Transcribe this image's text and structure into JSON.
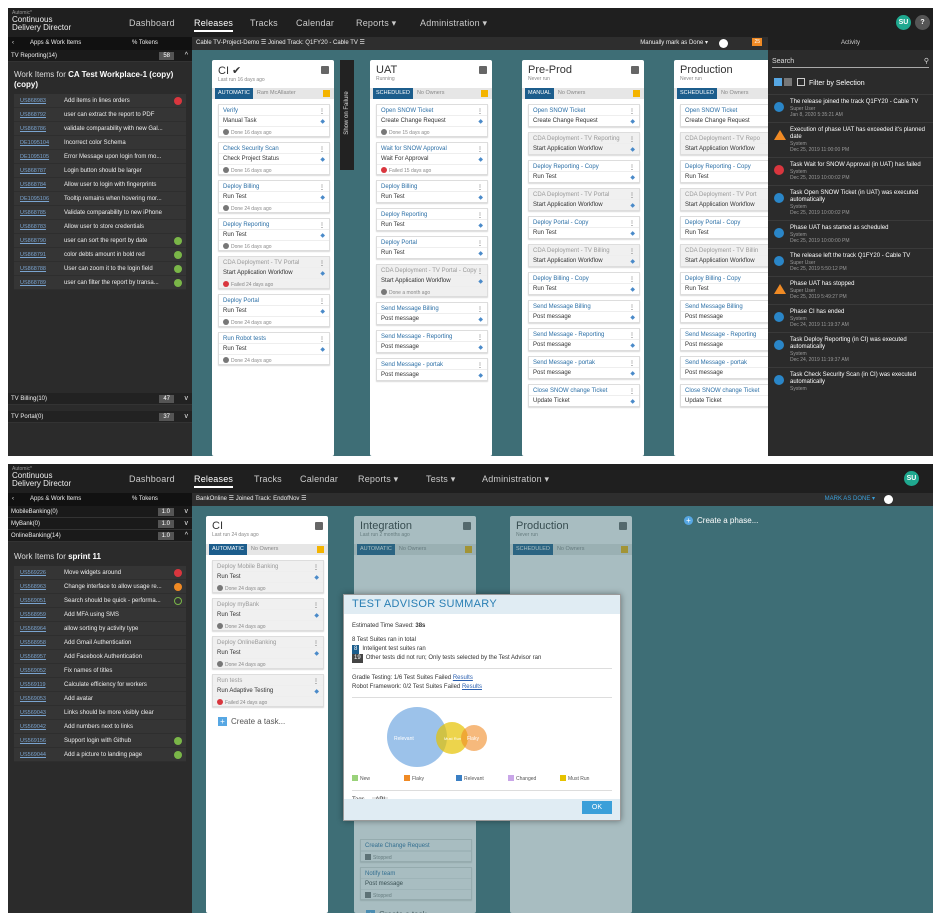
{
  "s1": {
    "brand_tag": "Automic*",
    "brand": "Continuous Delivery Director",
    "nav": [
      "Dashboard",
      "Releases",
      "Tracks",
      "Calendar",
      "Reports ▾",
      "Administration ▾"
    ],
    "avatar": "SU",
    "help": "?",
    "lefthead_apps": "Apps & Work Items",
    "lefthead_tokens": "% Tokens",
    "cat_top": {
      "label": "TV Reporting(14)",
      "count": "58"
    },
    "wi_title_pre": "Work Items for ",
    "wi_title_name": "CA Test Workplace-1 (copy) (copy)",
    "workitems": [
      {
        "id": "US868983",
        "title": "Add items in lines orders",
        "st": "red"
      },
      {
        "id": "US868792",
        "title": "user can extract the report to PDF",
        "st": ""
      },
      {
        "id": "US868786",
        "title": "validate comparability with new Gal...",
        "st": ""
      },
      {
        "id": "DE1095104",
        "title": "Incorrect color Schema",
        "st": ""
      },
      {
        "id": "DE1095105",
        "title": "Error Message upon login from mo...",
        "st": ""
      },
      {
        "id": "US868787",
        "title": "Login button should be larger",
        "st": ""
      },
      {
        "id": "US868784",
        "title": "Allow user to login with fingerprints",
        "st": ""
      },
      {
        "id": "DE1095106",
        "title": "Tooltip remains when hovering mor...",
        "st": ""
      },
      {
        "id": "US868785",
        "title": "Validate comparability to new iPhone",
        "st": ""
      },
      {
        "id": "US868783",
        "title": "Allow user to store credentials",
        "st": ""
      },
      {
        "id": "US868790",
        "title": "user can sort the report by date",
        "st": "green"
      },
      {
        "id": "US868791",
        "title": "color debts amount in bold red",
        "st": "green"
      },
      {
        "id": "US868788",
        "title": "User can zoom it to the login field",
        "st": "green"
      },
      {
        "id": "US868789",
        "title": "user can filter the report by transa...",
        "st": "green"
      }
    ],
    "cat_bottom": [
      {
        "label": "TV Billing(10)",
        "count": "47"
      },
      {
        "label": "TV Portal(0)",
        "count": "37"
      }
    ],
    "subbar": "Cable TV-Project-Demo ☰   Joined Track: Q1FY20 - Cable TV ☰",
    "subbar_right": "Manually mark as Done ▾",
    "notif": "25",
    "activity_title": "Activity",
    "search_label": "Search",
    "filter_label": "Filter by Selection",
    "show_failure": "Show on Failure",
    "phases": [
      {
        "name": "CI ✔",
        "sub": "Last run  16 days ago",
        "type": "AUTOMATIC",
        "owner": "Ram McAllaster",
        "tasks": [
          {
            "n": "Verify",
            "t": "Manual Task",
            "s": "Done 16 days ago",
            "g": false
          },
          {
            "n": "Check Security Scan",
            "t": "Check Project Status",
            "s": "Done 16 days ago",
            "g": false
          },
          {
            "n": "Deploy Billing",
            "t": "Run Test",
            "s": "Done 24 days ago",
            "g": false
          },
          {
            "n": "Deploy Reporting",
            "t": "Run Test",
            "s": "Done 16 days ago",
            "g": false
          },
          {
            "n": "CDA Deployment - TV Portal",
            "t": "Start Application Workflow",
            "s": "Failed 24 days ago",
            "g": true
          },
          {
            "n": "Deploy Portal",
            "t": "Run Test",
            "s": "Done 24 days ago",
            "g": false
          },
          {
            "n": "Run Robot tests",
            "t": "Run Test",
            "s": "Done 24 days ago",
            "g": false
          }
        ]
      },
      {
        "name": "UAT",
        "sub": "Running",
        "type": "SCHEDULED",
        "owner": "No Owners",
        "tasks": [
          {
            "n": "Open SNOW Ticket",
            "t": "Create Change Request",
            "s": "Done 15 days ago",
            "g": false
          },
          {
            "n": "Wait for SNOW Approval",
            "t": "Wait For Approval",
            "s": "Failed 15 days ago",
            "g": false
          },
          {
            "n": "Deploy Billing",
            "t": "Run Test",
            "s": "",
            "g": false
          },
          {
            "n": "Deploy Reporting",
            "t": "Run Test",
            "s": "",
            "g": false
          },
          {
            "n": "Deploy Portal",
            "t": "Run Test",
            "s": "",
            "g": false
          },
          {
            "n": "CDA Deployment - TV Portal - Copy",
            "t": "Start Application Workflow",
            "s": "Done a month ago",
            "g": true
          },
          {
            "n": "Send Message Billing",
            "t": "Post message",
            "s": "",
            "g": false
          },
          {
            "n": "Send Message - Reporting",
            "t": "Post message",
            "s": "",
            "g": false
          },
          {
            "n": "Send Message - portak",
            "t": "Post message",
            "s": "",
            "g": false
          }
        ]
      },
      {
        "name": "Pre-Prod",
        "sub": "Never run",
        "type": "MANUAL",
        "owner": "No Owners",
        "tasks": [
          {
            "n": "Open SNOW Ticket",
            "t": "Create Change Request",
            "s": "",
            "g": false
          },
          {
            "n": "CDA Deployment - TV Reporting",
            "t": "Start Application Workflow",
            "s": "",
            "g": true
          },
          {
            "n": "Deploy Reporting - Copy",
            "t": "Run Test",
            "s": "",
            "g": false
          },
          {
            "n": "CDA Deployment - TV Portal",
            "t": "Start Application Workflow",
            "s": "",
            "g": true
          },
          {
            "n": "Deploy Portal - Copy",
            "t": "Run Test",
            "s": "",
            "g": false
          },
          {
            "n": "CDA Deployment - TV Billing",
            "t": "Start Application Workflow",
            "s": "",
            "g": true
          },
          {
            "n": "Deploy Billing - Copy",
            "t": "Run Test",
            "s": "",
            "g": false
          },
          {
            "n": "Send Message Billing",
            "t": "Post message",
            "s": "",
            "g": false
          },
          {
            "n": "Send Message - Reporting",
            "t": "Post message",
            "s": "",
            "g": false
          },
          {
            "n": "Send Message - portak",
            "t": "Post message",
            "s": "",
            "g": false
          },
          {
            "n": "Close SNOW change Ticket",
            "t": "Update Ticket",
            "s": "",
            "g": false
          }
        ]
      },
      {
        "name": "Production",
        "sub": "Never run",
        "type": "SCHEDULED",
        "owner": "No Owners",
        "tasks": [
          {
            "n": "Open SNOW Ticket",
            "t": "Create Change Request",
            "s": "",
            "g": false
          },
          {
            "n": "CDA Deployment - TV Repo",
            "t": "Start Application Workflow",
            "s": "",
            "g": true
          },
          {
            "n": "Deploy Reporting - Copy",
            "t": "Run Test",
            "s": "",
            "g": false
          },
          {
            "n": "CDA Deployment - TV Port",
            "t": "Start Application Workflow",
            "s": "",
            "g": true
          },
          {
            "n": "Deploy Portal - Copy",
            "t": "Run Test",
            "s": "",
            "g": false
          },
          {
            "n": "CDA Deployment - TV Billin",
            "t": "Start Application Workflow",
            "s": "",
            "g": true
          },
          {
            "n": "Deploy Billing - Copy",
            "t": "Run Test",
            "s": "",
            "g": false
          },
          {
            "n": "Send Message Billing",
            "t": "Post message",
            "s": "",
            "g": false
          },
          {
            "n": "Send Message - Reporting",
            "t": "Post message",
            "s": "",
            "g": false
          },
          {
            "n": "Send Message - portak",
            "t": "Post message",
            "s": "",
            "g": false
          },
          {
            "n": "Close SNOW change Ticket",
            "t": "Update Ticket",
            "s": "",
            "g": false
          }
        ]
      }
    ],
    "activity": [
      {
        "icon": "info",
        "color": "#2a86c8",
        "m": "The release joined the track Q1FY20 - Cable TV",
        "u": "Super User",
        "d": "Jan 8, 2020 5:35:21 AM"
      },
      {
        "icon": "warn",
        "color": "#f08a24",
        "m": "Execution of phase UAT has exceeded it's planned date",
        "u": "System",
        "d": "Dec 25, 2019 11:00:00 PM"
      },
      {
        "icon": "fail",
        "color": "#d9363e",
        "m": "Task Wait for SNOW Approval (in UAT) has failed",
        "u": "System",
        "d": "Dec 25, 2019 10:00:02 PM"
      },
      {
        "icon": "info",
        "color": "#2a86c8",
        "m": "Task Open SNOW Ticket (in UAT) was executed automatically",
        "u": "System",
        "d": "Dec 25, 2019 10:00:02 PM"
      },
      {
        "icon": "info",
        "color": "#2a86c8",
        "m": "Phase UAT has started as scheduled",
        "u": "System",
        "d": "Dec 25, 2019 10:00:00 PM"
      },
      {
        "icon": "info",
        "color": "#2a86c8",
        "m": "The release left the track Q1FY20 - Cable TV",
        "u": "Super User",
        "d": "Dec 25, 2019 5:50:12 PM"
      },
      {
        "icon": "warn",
        "color": "#f08a24",
        "m": "Phase UAT has stopped",
        "u": "Super User",
        "d": "Dec 25, 2019 5:49:27 PM"
      },
      {
        "icon": "info",
        "color": "#2a86c8",
        "m": "Phase CI has ended",
        "u": "System",
        "d": "Dec 24, 2019 11:19:37 AM"
      },
      {
        "icon": "info",
        "color": "#2a86c8",
        "m": "Task Deploy Reporting (in CI) was executed automatically",
        "u": "System",
        "d": "Dec 24, 2019 11:19:37 AM"
      },
      {
        "icon": "info",
        "color": "#2a86c8",
        "m": "Task Check Security Scan (in CI) was executed automatically",
        "u": "System",
        "d": ""
      }
    ]
  },
  "s2": {
    "brand_tag": "Automic*",
    "brand": "Continuous Delivery Director",
    "nav": [
      "Dashboard",
      "Releases",
      "Tracks",
      "Calendar",
      "Reports ▾",
      "Tests ▾",
      "Administration ▾"
    ],
    "avatar": "SU",
    "lefthead_apps": "Apps & Work Items",
    "lefthead_tokens": "% Tokens",
    "cats": [
      {
        "label": "MobileBanking(0)",
        "count": "1.0"
      },
      {
        "label": "MyBank(0)",
        "count": "1.0"
      },
      {
        "label": "OnlineBanking(14)",
        "count": "1.0"
      }
    ],
    "wi_title_pre": "Work Items for ",
    "wi_title_name": "sprint 11",
    "workitems": [
      {
        "id": "US569226",
        "title": "Move widgets around",
        "st": "red"
      },
      {
        "id": "US568963",
        "title": "Change interface to allow usage re...",
        "st": "orange"
      },
      {
        "id": "US569051",
        "title": "Search should be quick - performa...",
        "st": "ring"
      },
      {
        "id": "US568959",
        "title": "Add MFA using SMS",
        "st": ""
      },
      {
        "id": "US568964",
        "title": "allow sorting by activity type",
        "st": ""
      },
      {
        "id": "US568958",
        "title": "Add Gmail Authentication",
        "st": ""
      },
      {
        "id": "US568957",
        "title": "Add Facebook Authentication",
        "st": ""
      },
      {
        "id": "US569052",
        "title": "Fix names of titles",
        "st": ""
      },
      {
        "id": "US569119",
        "title": "Calculate efficiency for workers",
        "st": ""
      },
      {
        "id": "US569053",
        "title": "Add avatar",
        "st": ""
      },
      {
        "id": "US569043",
        "title": "Links should be more visibly clear",
        "st": ""
      },
      {
        "id": "US569042",
        "title": "Add numbers next to links",
        "st": ""
      },
      {
        "id": "US569156",
        "title": "Support login with Github",
        "st": "green"
      },
      {
        "id": "US569044",
        "title": "Add a picture to landing page",
        "st": "green"
      }
    ],
    "subbar": "BankOnline ☰   Joined Track: EndofNov ☰",
    "mark_done": "MARK AS DONE ▾",
    "phases": [
      {
        "name": "CI",
        "sub": "Last run  24 days ago",
        "type": "AUTOMATIC",
        "owner": "No Owners",
        "tasks": [
          {
            "n": "Deploy Mobile Banking",
            "t": "Run Test",
            "s": "Done 24 days ago",
            "g": true
          },
          {
            "n": "Deploy myBank",
            "t": "Run Test",
            "s": "Done 24 days ago",
            "g": true
          },
          {
            "n": "Deploy OnlineBanking",
            "t": "Run Test",
            "s": "Done 24 days ago",
            "g": true
          },
          {
            "n": "Run tests",
            "t": "Run Adaptive Testing",
            "s": "Failed 24 days ago",
            "g": true
          }
        ]
      },
      {
        "name": "Integration",
        "sub": "Last run  2 months ago",
        "type": "AUTOMATIC",
        "owner": "No Owners",
        "tasks": []
      },
      {
        "name": "Production",
        "sub": "Never run",
        "type": "SCHEDULED",
        "owner": "No Owners",
        "tasks": []
      }
    ],
    "create_task": "Create a task...",
    "create_phase": "Create a phase...",
    "under_modal": [
      {
        "n": "Create Change Request",
        "t": "",
        "s": "Stopped"
      },
      {
        "n": "Notify team",
        "t": "Post message",
        "s": "Stopped"
      }
    ],
    "modal": {
      "title": "TEST ADVISOR SUMMARY",
      "saved_label": "Estimated Time Saved:",
      "saved_value": "38s",
      "total": "8 Test Suites ran in total",
      "ran_count": "8",
      "ran_text": "Inteligent test suites ran",
      "skip_count": "19",
      "skip_text": "Other tests did not run; Only tests selected by the Test Advisor ran",
      "gradle": "Gradle Testing: 1/6 Test Suites Failed",
      "robot": "Robot Framework: 0/2 Test Suites Failed",
      "results": "Results",
      "venn": [
        "Relevant",
        "Must Run",
        "Flaky"
      ],
      "legend": [
        {
          "label": "New",
          "color": "#9ad27a"
        },
        {
          "label": "Flaky",
          "color": "#f08a24"
        },
        {
          "label": "Relevant",
          "color": "#3a7fc4"
        },
        {
          "label": "Changed",
          "color": "#c9a6e8"
        },
        {
          "label": "Must Run",
          "color": "#e6c200"
        }
      ],
      "tags_label": "Tags",
      "tag": "API",
      "ok": "OK"
    }
  }
}
